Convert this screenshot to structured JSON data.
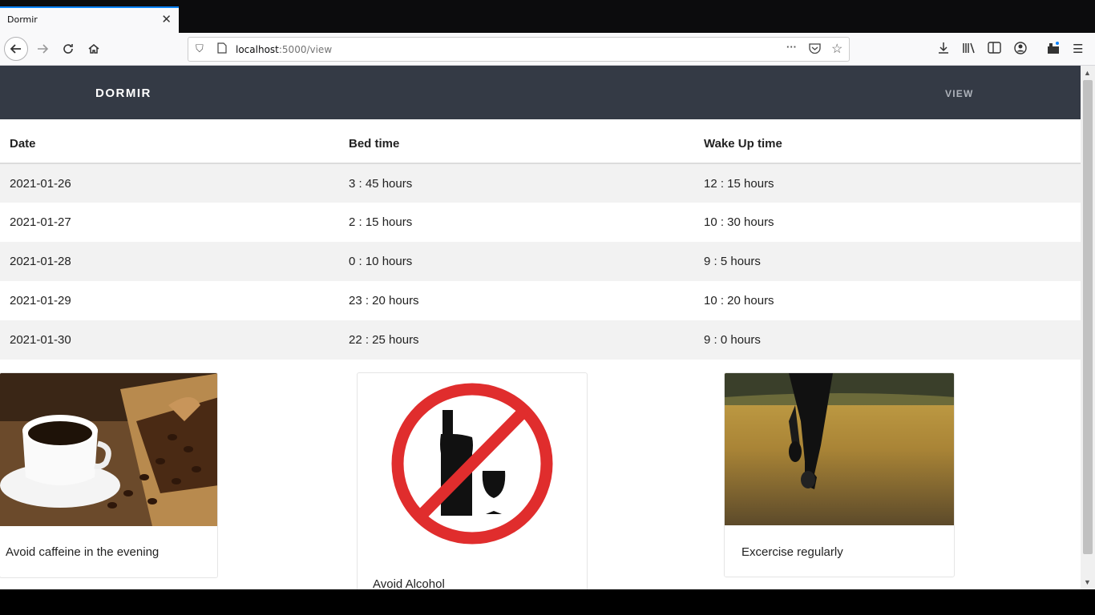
{
  "browser": {
    "tab_title": "Dormir",
    "url_host": "localhost",
    "url_rest": ":5000/view"
  },
  "app": {
    "brand": "DORMIR",
    "nav_view": "VIEW"
  },
  "table": {
    "headers": [
      "Date",
      "Bed time",
      "Wake Up time"
    ],
    "rows": [
      [
        "2021-01-26",
        "3 : 45 hours",
        "12 : 15 hours"
      ],
      [
        "2021-01-27",
        "2 : 15 hours",
        "10 : 30 hours"
      ],
      [
        "2021-01-28",
        "0 : 10 hours",
        "9 : 5 hours"
      ],
      [
        "2021-01-29",
        "23 : 20 hours",
        "10 : 20 hours"
      ],
      [
        "2021-01-30",
        "22 : 25 hours",
        "9 : 0 hours"
      ]
    ]
  },
  "cards": [
    {
      "text": "Avoid caffeine in the evening",
      "icon": "coffee-cup-image"
    },
    {
      "text": "Avoid Alcohol",
      "icon": "no-alcohol-sign"
    },
    {
      "text": "Excercise regularly",
      "icon": "runner-image"
    }
  ]
}
